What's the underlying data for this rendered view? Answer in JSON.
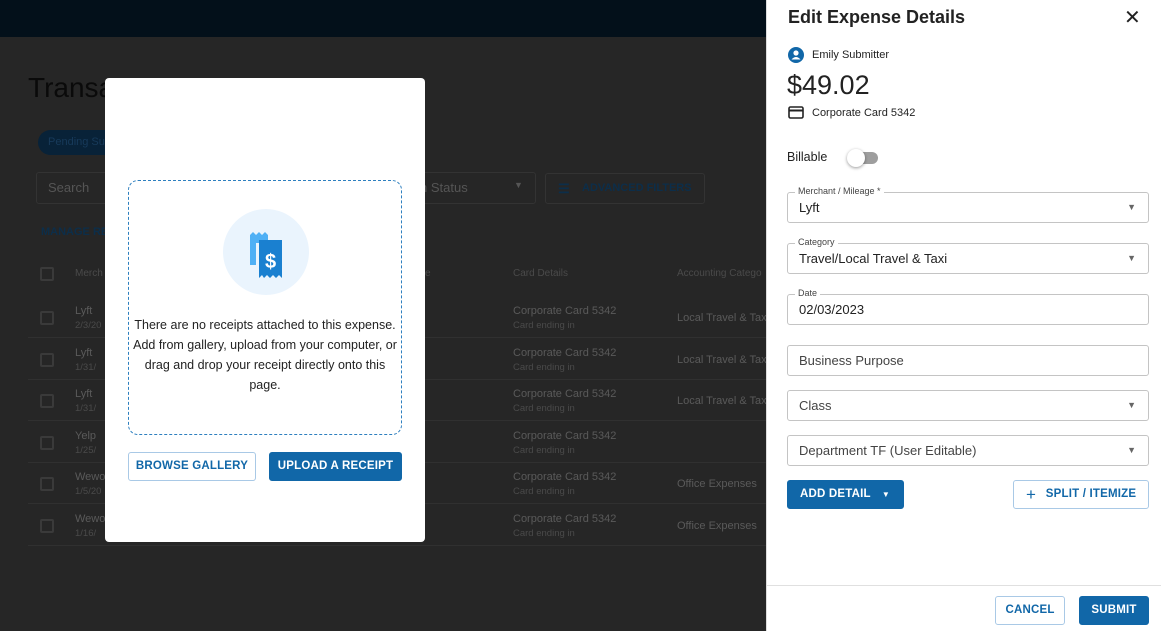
{
  "background": {
    "page_title": "Transa",
    "chip": "Pending Sub",
    "search_placeholder": "Search",
    "status_filter": "n Status",
    "advanced_filters": "ADVANCED FILTERS",
    "manage": "MANAGE RE",
    "headers": [
      "Merch",
      "e",
      "Card Details",
      "Accounting Catego"
    ],
    "rows": [
      {
        "merchant": "Lyft",
        "date": "2/3/20",
        "card": "Corporate Card 5342",
        "card_sub": "Card ending in",
        "category": "Local Travel & Tax"
      },
      {
        "merchant": "Lyft",
        "date": "1/31/",
        "card": "Corporate Card 5342",
        "card_sub": "Card ending in",
        "category": "Local Travel & Tax"
      },
      {
        "merchant": "Lyft",
        "date": "1/31/",
        "card": "Corporate Card 5342",
        "card_sub": "Card ending in",
        "category": "Local Travel & Tax"
      },
      {
        "merchant": "Yelp",
        "date": "1/25/",
        "card": "Corporate Card 5342",
        "card_sub": "Card ending in",
        "category": ""
      },
      {
        "merchant": "Wewo",
        "date": "1/5/20",
        "card": "Corporate Card 5342",
        "card_sub": "Card ending in",
        "category": "Office Expenses"
      },
      {
        "merchant": "Wewo",
        "date": "1/16/",
        "card": "Corporate Card 5342",
        "card_sub": "Card ending in",
        "category": "Office Expenses"
      }
    ]
  },
  "modal": {
    "message": "There are no receipts attached to this expense. Add from gallery, upload from your computer, or drag and drop your receipt directly onto this page.",
    "browse": "BROWSE GALLERY",
    "upload": "UPLOAD A RECEIPT",
    "icon": "receipt-dollar-icon"
  },
  "panel": {
    "title": "Edit Expense Details",
    "user": "Emily Submitter",
    "amount": "$49.02",
    "card": "Corporate Card 5342",
    "billable_label": "Billable",
    "billable_on": false,
    "merchant_label": "Merchant / Mileage *",
    "merchant": "Lyft",
    "category_label": "Category",
    "category": "Travel/Local Travel & Taxi",
    "date_label": "Date",
    "date": "02/03/2023",
    "business_purpose": "Business Purpose",
    "class": "Class",
    "department": "Department TF (User Editable)",
    "add_detail": "ADD DETAIL",
    "split": "SPLIT / ITEMIZE",
    "cancel": "CANCEL",
    "submit": "SUBMIT"
  },
  "colors": {
    "primary": "#1167a8",
    "overlay": "#262626",
    "topbar": "#03101a"
  }
}
